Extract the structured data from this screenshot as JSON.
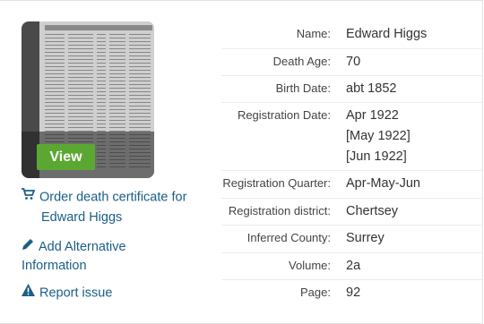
{
  "image": {
    "view_label": "View"
  },
  "actions": {
    "order_line1": "Order death certificate for",
    "order_line2": "Edward Higgs",
    "alt_line1": "Add Alternative",
    "alt_line2": "Information",
    "report": "Report issue"
  },
  "details": [
    {
      "label": "Name:",
      "values": [
        "Edward Higgs"
      ]
    },
    {
      "label": "Death Age:",
      "values": [
        "70"
      ]
    },
    {
      "label": "Birth Date:",
      "values": [
        "abt 1852"
      ]
    },
    {
      "label": "Registration Date:",
      "values": [
        "Apr 1922",
        "[May 1922]",
        "[Jun 1922]"
      ]
    },
    {
      "label": "Registration Quarter:",
      "values": [
        "Apr-May-Jun"
      ]
    },
    {
      "label": "Registration district:",
      "values": [
        "Chertsey"
      ]
    },
    {
      "label": "Inferred County:",
      "values": [
        "Surrey"
      ]
    },
    {
      "label": "Volume:",
      "values": [
        "2a"
      ]
    },
    {
      "label": "Page:",
      "values": [
        "92"
      ]
    }
  ],
  "colors": {
    "link": "#1a5e86",
    "view_button": "#5aa832"
  },
  "icons": {
    "order": "cart-icon",
    "alt": "pencil-icon",
    "report": "warning-icon"
  }
}
